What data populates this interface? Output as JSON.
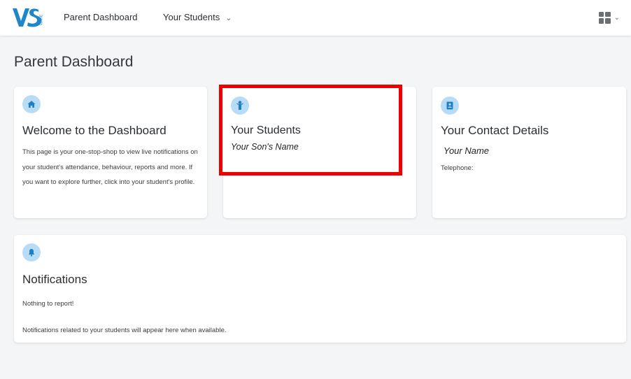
{
  "header": {
    "logo_icon": "vsware-logo",
    "logo_text": "WARE",
    "nav": {
      "dashboard": "Parent Dashboard",
      "students": "Your Students"
    },
    "apps_icon": "apps-grid-icon"
  },
  "page": {
    "title": "Parent Dashboard"
  },
  "cards": {
    "welcome": {
      "icon": "home-icon",
      "title": "Welcome to the Dashboard",
      "text": "This page is your one-stop-shop to view live notifications on your student's attendance, behaviour, reports and more. If you want to explore further, click into your student's profile."
    },
    "students": {
      "icon": "student-icon",
      "title": "Your Students",
      "student_name": "Your Son's Name"
    },
    "contact": {
      "icon": "contact-card-icon",
      "title": "Your Contact Details",
      "name": "Your Name",
      "telephone_label": "Telephone:"
    },
    "notifications": {
      "icon": "bell-icon",
      "title": "Notifications",
      "empty_text": "Nothing to report!",
      "info_text": "Notifications related to your students will appear here when available."
    }
  },
  "colors": {
    "accent_icon_bg": "#b9dcf6",
    "accent_icon_fg": "#1f7fc4",
    "logo_blue": "#1f86c9",
    "highlight_red": "#ee0000"
  }
}
